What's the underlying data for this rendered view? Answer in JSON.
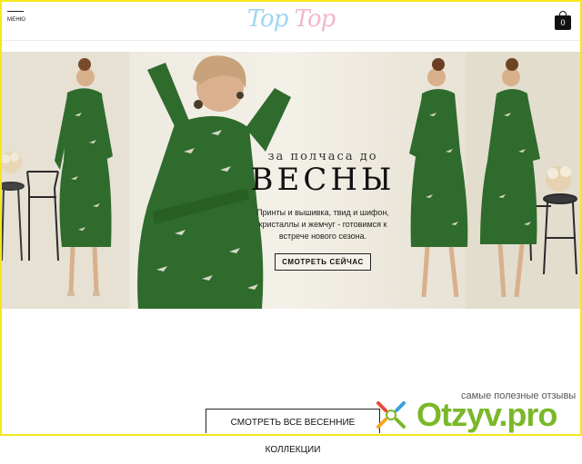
{
  "header": {
    "menu_label": "МЕНЮ",
    "logo_part1": "Top",
    "logo_part2": "Top",
    "cart_count": "0"
  },
  "hero": {
    "subtitle": "за полчаса до",
    "title": "ВЕСНЫ",
    "description": "Принты и вышивка, твид и шифон, кристаллы и жемчуг - готовимся к встрече нового сезона.",
    "cta_label": "СМОТРЕТЬ СЕЙЧАС"
  },
  "collections": {
    "button_label": "СМОТРЕТЬ ВСЕ ВЕСЕННИЕ КОЛЛЕКЦИИ"
  },
  "watermark": {
    "tagline": "самые полезные отзывы",
    "brand": "Otzyv.pro"
  },
  "colors": {
    "dress_green": "#2f6b2c",
    "border_yellow": "#f4e71c",
    "brand_green": "#7ab828"
  }
}
